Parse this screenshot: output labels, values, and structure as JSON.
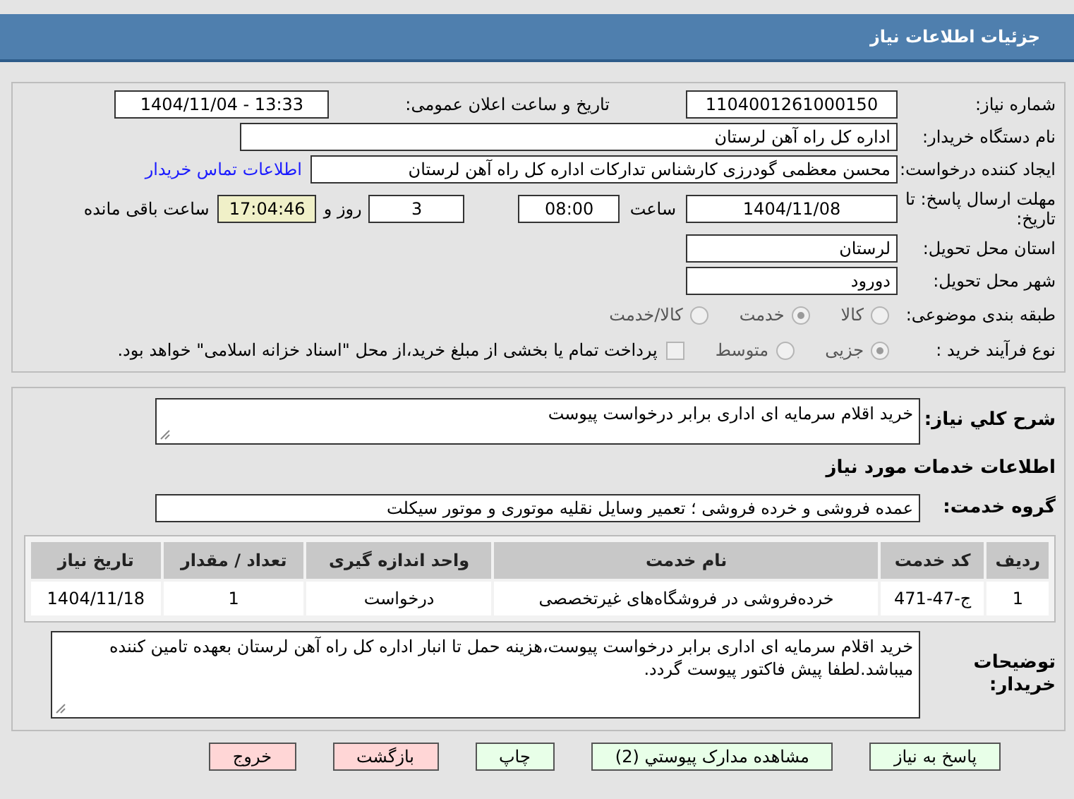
{
  "header": {
    "title": "جزئیات اطلاعات نیاز"
  },
  "details": {
    "need_number": {
      "label": "شماره نیاز:",
      "value": "1104001261000150"
    },
    "announce": {
      "label": "تاریخ و ساعت اعلان عمومی:",
      "value": "1404/11/04 - 13:33"
    },
    "buyer": {
      "label": "نام دستگاه خریدار:",
      "value": "اداره کل راه آهن لرستان"
    },
    "creator": {
      "label": "ایجاد کننده درخواست:",
      "value": "محسن معظمی گودرزی کارشناس تدارکات اداره کل راه آهن لرستان",
      "link": "اطلاعات تماس خریدار"
    },
    "deadline": {
      "label": "مهلت ارسال پاسخ: تا تاریخ:",
      "date": "1404/11/08",
      "time_label": "ساعت",
      "time": "08:00",
      "days": "3",
      "days_label": "روز و",
      "remaining": "17:04:46",
      "remaining_label": "ساعت باقی مانده"
    },
    "province": {
      "label": "استان محل تحویل:",
      "value": "لرستان"
    },
    "city": {
      "label": "شهر محل تحویل:",
      "value": "دورود"
    },
    "category": {
      "label": "طبقه بندی موضوعی:",
      "options": [
        {
          "label": "کالا",
          "selected": false
        },
        {
          "label": "خدمت",
          "selected": true
        },
        {
          "label": "کالا/خدمت",
          "selected": false
        }
      ]
    },
    "process": {
      "label": "نوع فرآیند خرید :",
      "options": [
        {
          "label": "جزیی",
          "selected": true
        },
        {
          "label": "متوسط",
          "selected": false
        }
      ],
      "treasury": {
        "checked": false,
        "text": "پرداخت تمام یا بخشی از مبلغ خرید،از محل \"اسناد خزانه اسلامی\" خواهد بود."
      }
    }
  },
  "services": {
    "summary": {
      "label": "شرح کلي نياز:",
      "value": "خرید اقلام سرمایه ای اداری برابر درخواست پیوست"
    },
    "heading": "اطلاعات خدمات مورد نیاز",
    "group": {
      "label": "گروه خدمت:",
      "value": "عمده فروشی و خرده فروشی ؛ تعمیر وسایل نقلیه موتوری و موتور سیکلت"
    },
    "table": {
      "columns": [
        "ردیف",
        "کد خدمت",
        "نام خدمت",
        "واحد اندازه گیری",
        "تعداد / مقدار",
        "تاریخ نیاز"
      ],
      "rows": [
        [
          "1",
          "ج-47-471",
          "خرده‌فروشی در فروشگاه‌های غیرتخصصی",
          "درخواست",
          "1",
          "1404/11/18"
        ]
      ]
    },
    "notes": {
      "label": "توضیحات خریدار:",
      "value": "خرید اقلام سرمایه ای اداری برابر درخواست پیوست،هزینه حمل تا انبار اداره کل راه آهن لرستان بعهده تامین کننده میباشد.لطفا پیش فاکتور پیوست گردد."
    }
  },
  "buttons": [
    {
      "label": "پاسخ به نیاز",
      "kind": "normal"
    },
    {
      "label": "مشاهده مدارک پیوستي (2)",
      "kind": "normal"
    },
    {
      "label": "چاپ",
      "kind": "normal"
    },
    {
      "label": "بازگشت",
      "kind": "danger"
    },
    {
      "label": "خروج",
      "kind": "danger"
    }
  ]
}
